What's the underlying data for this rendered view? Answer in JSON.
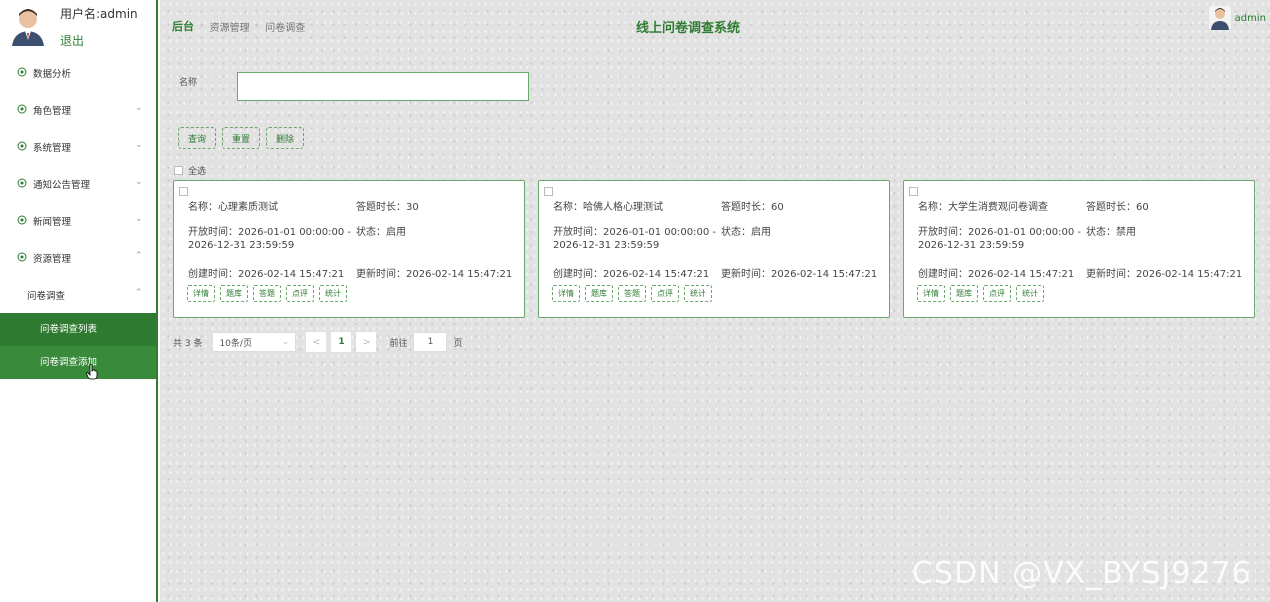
{
  "user": {
    "name_label": "用户名:admin",
    "logout": "退出"
  },
  "menu": [
    {
      "label": "数据分析",
      "icon": "location-icon",
      "arrow": ""
    },
    {
      "label": "角色管理",
      "icon": "location-icon",
      "arrow": "⌄"
    },
    {
      "label": "系统管理",
      "icon": "location-icon",
      "arrow": "⌄"
    },
    {
      "label": "通知公告管理",
      "icon": "location-icon",
      "arrow": "⌄"
    },
    {
      "label": "新闻管理",
      "icon": "location-icon",
      "arrow": "⌄"
    },
    {
      "label": "资源管理",
      "icon": "location-icon",
      "arrow": "⌃"
    }
  ],
  "submenu_group": {
    "label": "问卷调查",
    "arrow": "⌃"
  },
  "submenu": [
    {
      "label": "问卷调查列表"
    },
    {
      "label": "问卷调查添加"
    }
  ],
  "breadcrumb": {
    "home": "后台",
    "level1": "资源管理",
    "level2": "问卷调查"
  },
  "site_title": "线上问卷调查系统",
  "top_user": {
    "name": "admin"
  },
  "search": {
    "label": "名称",
    "value": "",
    "placeholder": ""
  },
  "buttons": {
    "query": "查询",
    "reset": "重置",
    "delete": "删除"
  },
  "select_all": "全选",
  "cards": [
    {
      "name": "名称：心理素质测试",
      "duration": "答题时长：30",
      "open_time_1": "开放时间：2026-01-01 00:00:00 -",
      "open_time_2": "2026-12-31 23:59:59",
      "status": "状态：启用",
      "created": "创建时间：2026-02-14 15:47:21",
      "updated": "更新时间：2026-02-14 15:47:21",
      "actions": [
        "详情",
        "题库",
        "答题",
        "点评",
        "统计"
      ]
    },
    {
      "name": "名称：哈佛人格心理测试",
      "duration": "答题时长：60",
      "open_time_1": "开放时间：2026-01-01 00:00:00 -",
      "open_time_2": "2026-12-31 23:59:59",
      "status": "状态：启用",
      "created": "创建时间：2026-02-14 15:47:21",
      "updated": "更新时间：2026-02-14 15:47:21",
      "actions": [
        "详情",
        "题库",
        "答题",
        "点评",
        "统计"
      ]
    },
    {
      "name": "名称：大学生消费观问卷调查",
      "duration": "答题时长：60",
      "open_time_1": "开放时间：2026-01-01 00:00:00 -",
      "open_time_2": "2026-12-31 23:59:59",
      "status": "状态：禁用",
      "created": "创建时间：2026-02-14 15:47:21",
      "updated": "更新时间：2026-02-14 15:47:21",
      "actions": [
        "详情",
        "题库",
        "点评",
        "统计"
      ]
    }
  ],
  "pager": {
    "total": "共 3 条",
    "size": "10条/页",
    "prev": "<",
    "page": "1",
    "next": ">",
    "goto": "前往",
    "jump": "1",
    "unit": "页"
  },
  "watermark": "CSDN @VX_BYSJ9276",
  "colors": {
    "accent": "#2e7d32",
    "submenu_bg": "#3a8a3c",
    "card_border": "#6aa86c"
  }
}
